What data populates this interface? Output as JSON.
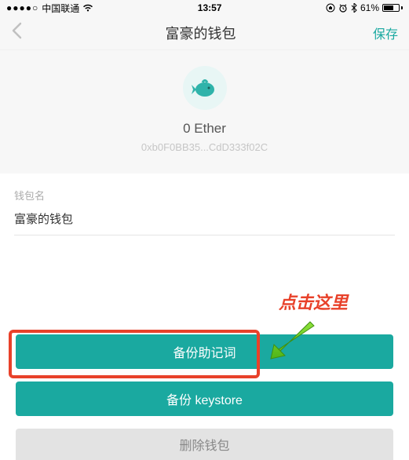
{
  "status": {
    "signal_dots": "●●●●○",
    "carrier": "中国联通",
    "time": "13:57",
    "battery_pct": "61%"
  },
  "nav": {
    "title": "富豪的钱包",
    "save": "保存"
  },
  "wallet": {
    "balance": "0 Ether",
    "address": "0xb0F0BB35...CdD333f02C",
    "name_label": "钱包名",
    "name_value": "富豪的钱包"
  },
  "buttons": {
    "backup_mnemonic": "备份助记词",
    "backup_keystore": "备份 keystore",
    "delete_wallet": "删除钱包"
  },
  "annotation": {
    "text": "点击这里"
  }
}
